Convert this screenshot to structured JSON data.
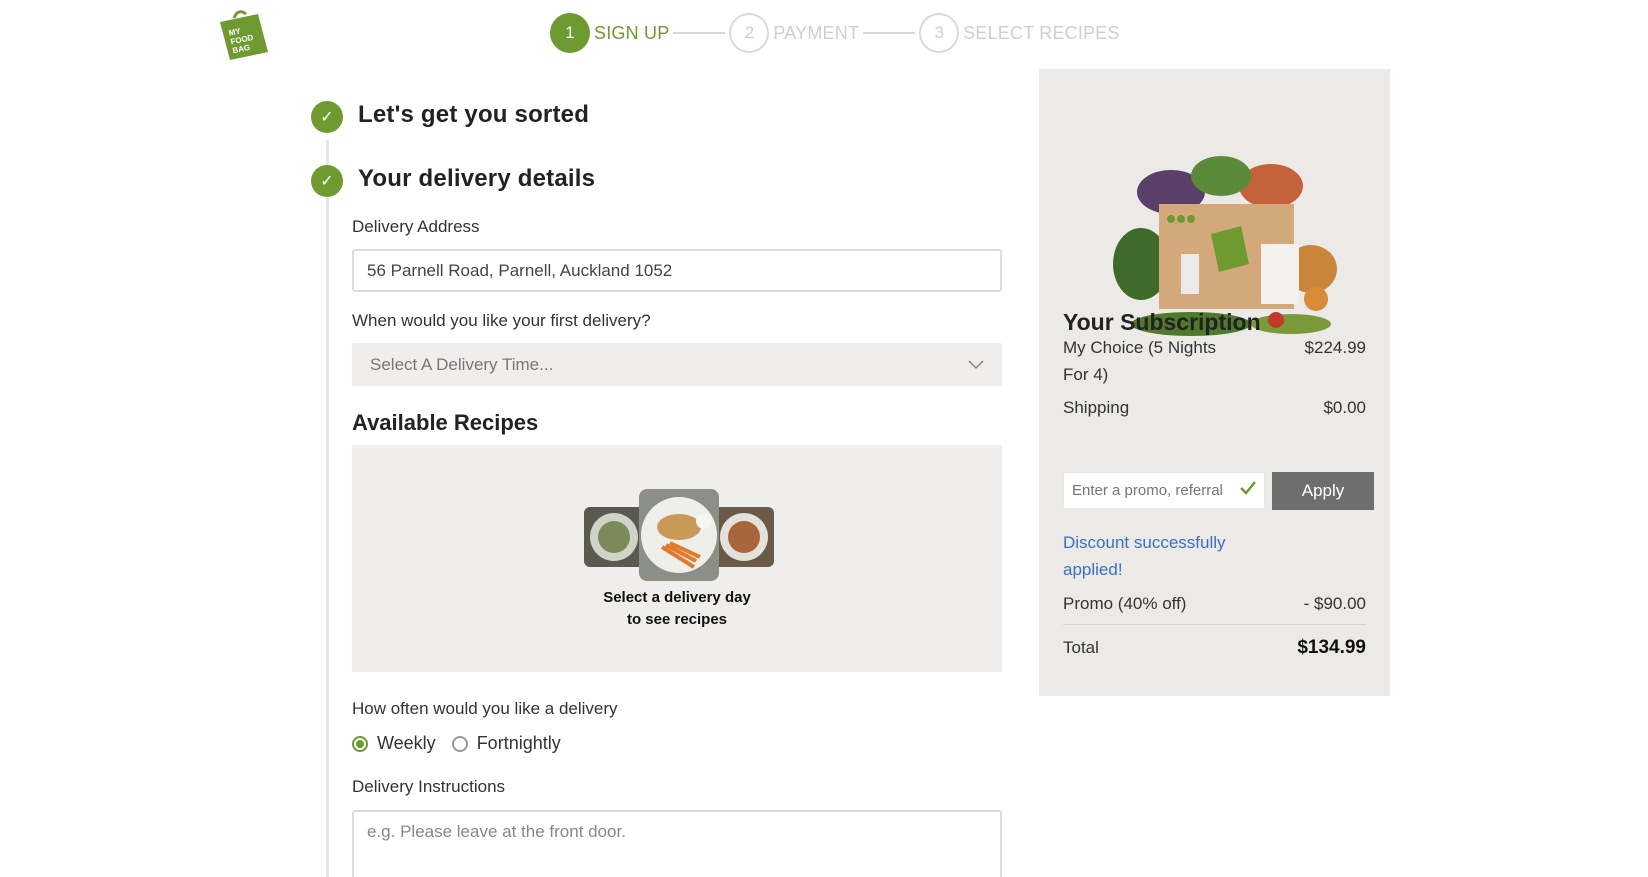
{
  "logo": {
    "text": "MY FOOD BAG",
    "color": "#6f9a2f"
  },
  "stepper": [
    {
      "number": "1",
      "label": "SIGN UP",
      "state": "active"
    },
    {
      "number": "2",
      "label": "PAYMENT",
      "state": "inactive"
    },
    {
      "number": "3",
      "label": "SELECT RECIPES",
      "state": "inactive"
    }
  ],
  "sections": {
    "sorted_title": "Let's get you sorted",
    "delivery_title": "Your delivery details"
  },
  "form": {
    "address_label": "Delivery Address",
    "address_value": "56 Parnell Road, Parnell, Auckland 1052",
    "first_delivery_label": "When would you like your first delivery?",
    "delivery_time_placeholder": "Select A Delivery Time...",
    "recipes_title": "Available Recipes",
    "recipes_message_line1": "Select a delivery day",
    "recipes_message_line2": "to see recipes",
    "frequency_label": "How often would you like a delivery",
    "frequency_options": [
      {
        "label": "Weekly",
        "checked": true
      },
      {
        "label": "Fortnightly",
        "checked": false
      }
    ],
    "instructions_label": "Delivery Instructions",
    "instructions_placeholder": "e.g. Please leave at the front door."
  },
  "summary": {
    "title": "Your Subscription",
    "plan_name": "My Choice (5 Nights For 4)",
    "plan_price": "$224.99",
    "shipping_label": "Shipping",
    "shipping_price": "$0.00",
    "promo_placeholder": "Enter a promo, referral",
    "apply_label": "Apply",
    "discount_message": "Discount successfully applied!",
    "promo_label": "Promo (40% off)",
    "promo_amount": "- $90.00",
    "total_label": "Total",
    "total_amount": "$134.99"
  },
  "colors": {
    "brand_green": "#6f9a2f",
    "panel_bg": "#ebeae7",
    "link_blue": "#3b6fc0",
    "apply_button": "#6e6e6e"
  }
}
